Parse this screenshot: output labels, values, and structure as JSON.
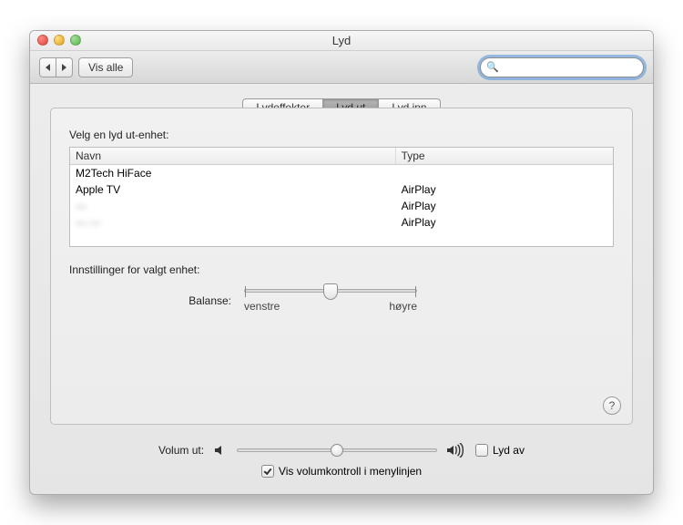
{
  "window": {
    "title": "Lyd"
  },
  "toolbar": {
    "show_all": "Vis alle"
  },
  "search": {
    "placeholder": ""
  },
  "tabs": {
    "effects": "Lydeffekter",
    "output": "Lyd ut",
    "input": "Lyd inn"
  },
  "output": {
    "choose_label": "Velg en lyd ut-enhet:",
    "columns": {
      "name": "Navn",
      "type": "Type"
    },
    "devices": [
      {
        "name": "M2Tech HiFace",
        "type": ""
      },
      {
        "name": "Apple TV",
        "type": "AirPlay"
      },
      {
        "name": "—",
        "type": "AirPlay",
        "blur": true
      },
      {
        "name": "— —",
        "type": "AirPlay",
        "blur": true
      }
    ],
    "settings_label": "Innstillinger for valgt enhet:",
    "balance": {
      "label": "Balanse:",
      "left": "venstre",
      "right": "høyre",
      "value": 0.5
    }
  },
  "volume": {
    "label": "Volum ut:",
    "mute_label": "Lyd av",
    "mute_checked": false,
    "show_in_menubar_label": "Vis volumkontroll i menylinjen",
    "show_in_menubar_checked": true,
    "value": 0.5
  },
  "help": {
    "glyph": "?"
  }
}
